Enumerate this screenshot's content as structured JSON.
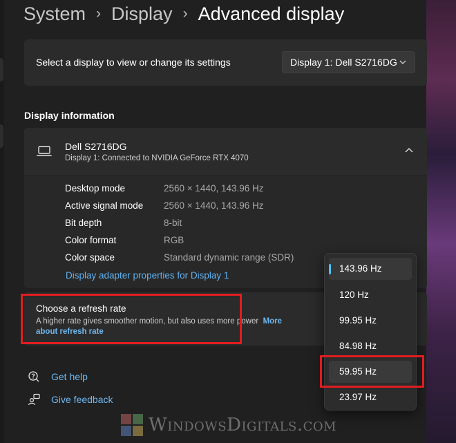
{
  "breadcrumb": {
    "items": [
      "System",
      "Display"
    ],
    "current": "Advanced display"
  },
  "display_select": {
    "label": "Select a display to view or change its settings",
    "value": "Display 1: Dell S2716DG"
  },
  "display_info": {
    "heading": "Display information",
    "name": "Dell S2716DG",
    "subtitle": "Display 1: Connected to NVIDIA GeForce RTX 4070",
    "rows": [
      {
        "label": "Desktop mode",
        "value": "2560 × 1440, 143.96 Hz"
      },
      {
        "label": "Active signal mode",
        "value": "2560 × 1440, 143.96 Hz"
      },
      {
        "label": "Bit depth",
        "value": "8-bit"
      },
      {
        "label": "Color format",
        "value": "RGB"
      },
      {
        "label": "Color space",
        "value": "Standard dynamic range (SDR)"
      }
    ],
    "adapter_link": "Display adapter properties for Display 1"
  },
  "refresh": {
    "title": "Choose a refresh rate",
    "description": "A higher rate gives smoother motion, but also uses more power",
    "more_link": "More about refresh rate",
    "options": [
      "143.96 Hz",
      "120 Hz",
      "99.95 Hz",
      "84.98 Hz",
      "59.95 Hz",
      "23.97 Hz"
    ],
    "selected": "143.96 Hz",
    "hovered": "59.95 Hz"
  },
  "help": {
    "get_help": "Get help",
    "give_feedback": "Give feedback"
  },
  "watermark": "WindowsDigitals.com",
  "colors": {
    "accent": "#4cc2ff",
    "link": "#6fb8f0",
    "highlight": "#e21c21"
  },
  "icons": [
    "chevron-right-icon",
    "chevron-down-icon",
    "laptop-icon",
    "chevron-up-icon",
    "help-icon",
    "feedback-icon",
    "windows-logo-icon"
  ]
}
